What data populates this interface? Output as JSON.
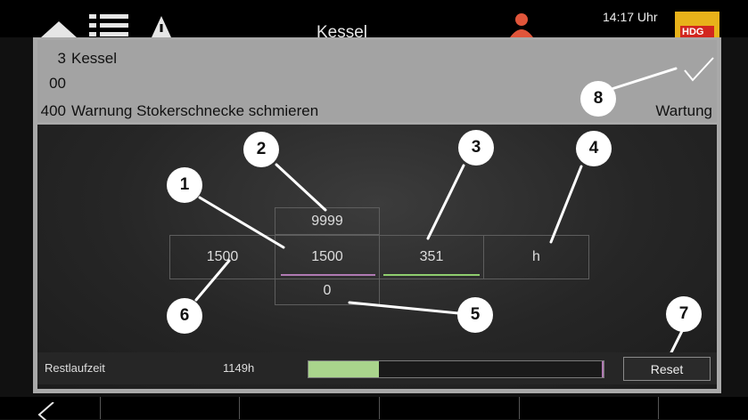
{
  "topbar": {
    "title": "Kessel",
    "time": "14:17 Uhr",
    "logo_text": "HDG",
    "icons": [
      "home-icon",
      "menu-list-icon",
      "warning-icon",
      "user-icon"
    ]
  },
  "message": {
    "rows": [
      {
        "num": "3",
        "text": "Kessel"
      },
      {
        "num": "00",
        "text": ""
      },
      {
        "num": "400",
        "text": "Warnung Stokerschnecke schmieren"
      }
    ],
    "status": "Wartung",
    "check_icon": "checkmark-icon"
  },
  "maintenance": {
    "max_value": "9999",
    "left_value": "1500",
    "interval_value": "1500",
    "current_value": "351",
    "unit": "h",
    "min_value": "0",
    "colors": {
      "interval_underline": "#b07ab3",
      "current_underline": "#8fce6e"
    }
  },
  "annotations": {
    "b1": "1",
    "b2": "2",
    "b3": "3",
    "b4": "4",
    "b5": "5",
    "b6": "6",
    "b7": "7",
    "b8": "8"
  },
  "restlaufzeit": {
    "label": "Restlaufzeit",
    "value": "1149h",
    "progress": 0.24,
    "reset_label": "Reset"
  },
  "colors": {
    "accent_green": "#a9d48c",
    "logo_yellow": "#e8b21a",
    "logo_red": "#d2261e",
    "user_icon": "#e0553a"
  }
}
